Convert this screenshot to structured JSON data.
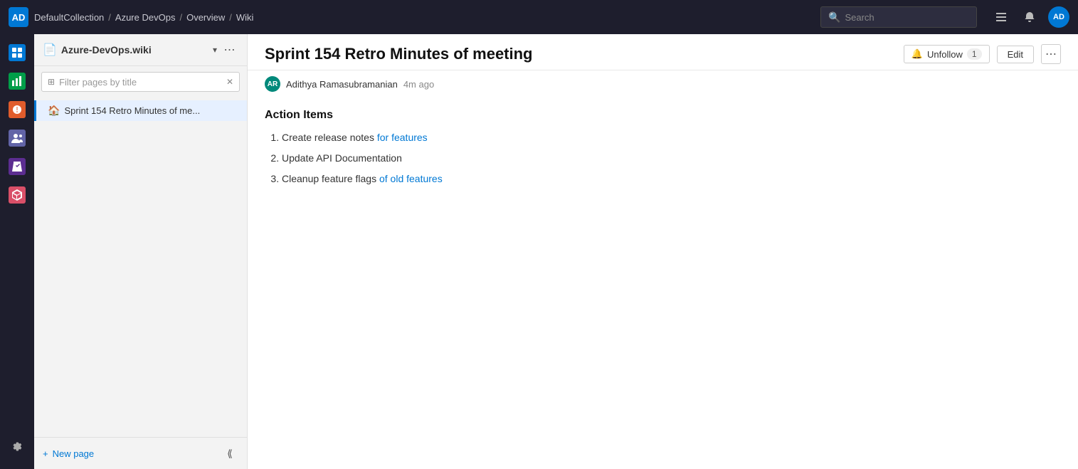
{
  "topbar": {
    "logo_text": "AD",
    "breadcrumb": [
      {
        "label": "DefaultCollection",
        "href": "#"
      },
      {
        "label": "Azure DevOps",
        "href": "#"
      },
      {
        "label": "Overview",
        "href": "#"
      },
      {
        "label": "Wiki",
        "href": "#"
      }
    ],
    "search_placeholder": "Search",
    "user_avatar": "AD",
    "icons": {
      "list": "≡",
      "bag": "🛍",
      "search": "🔍"
    }
  },
  "sidebar": {
    "wiki_title": "Azure-DevOps.wiki",
    "filter_placeholder": "Filter pages by title",
    "page_item_label": "Sprint 154 Retro Minutes of me...",
    "new_page_label": "New page"
  },
  "content": {
    "title": "Sprint 154 Retro Minutes of meeting",
    "author_initials": "AR",
    "author_name": "Adithya Ramasubramanian",
    "edit_time": "4m ago",
    "unfollow_label": "Unfollow",
    "follower_count": "1",
    "edit_label": "Edit",
    "more_label": "⋯",
    "section_heading": "Action Items",
    "action_items": [
      {
        "text": "Create release notes ",
        "link_text": "for features",
        "rest": ""
      },
      {
        "text": "Update API Documentation",
        "link_text": "",
        "rest": ""
      },
      {
        "text": "Cleanup feature flags ",
        "link_text": "of old features",
        "rest": ""
      }
    ]
  },
  "rail_icons": [
    {
      "icon": "📋",
      "label": "Boards",
      "active": false
    },
    {
      "icon": "📊",
      "label": "Reports",
      "active": false
    },
    {
      "icon": "🔴",
      "label": "Bugs",
      "active": false
    },
    {
      "icon": "🤝",
      "label": "Teams",
      "active": false
    },
    {
      "icon": "🧪",
      "label": "Test",
      "active": false
    },
    {
      "icon": "📦",
      "label": "Packages",
      "active": false
    }
  ]
}
